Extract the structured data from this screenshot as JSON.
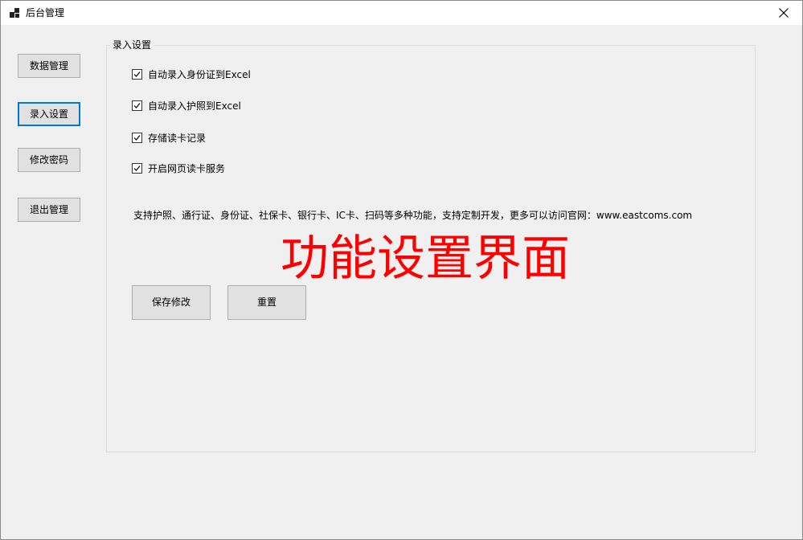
{
  "window": {
    "title": "后台管理",
    "close_glyph": "close-icon"
  },
  "sidebar": {
    "items": [
      {
        "label": "数据管理"
      },
      {
        "label": "录入设置",
        "active": true
      },
      {
        "label": "修改密码"
      },
      {
        "label": "退出管理"
      }
    ]
  },
  "group": {
    "legend": "录入设置",
    "checkboxes": [
      {
        "label": "自动录入身份证到Excel",
        "checked": true
      },
      {
        "label": "自动录入护照到Excel",
        "checked": true
      },
      {
        "label": "存储读卡记录",
        "checked": true
      },
      {
        "label": "开启网页读卡服务",
        "checked": true
      }
    ],
    "info": "支持护照、通行证、身份证、社保卡、银行卡、IC卡、扫码等多种功能，支持定制开发，更多可以访问官网：www.eastcoms.com",
    "big_title": "功能设置界面",
    "save_label": "保存修改",
    "reset_label": "重置"
  },
  "colors": {
    "accent": "#0078d7",
    "big_title": "#ff0000",
    "background": "#f0f0f0"
  }
}
